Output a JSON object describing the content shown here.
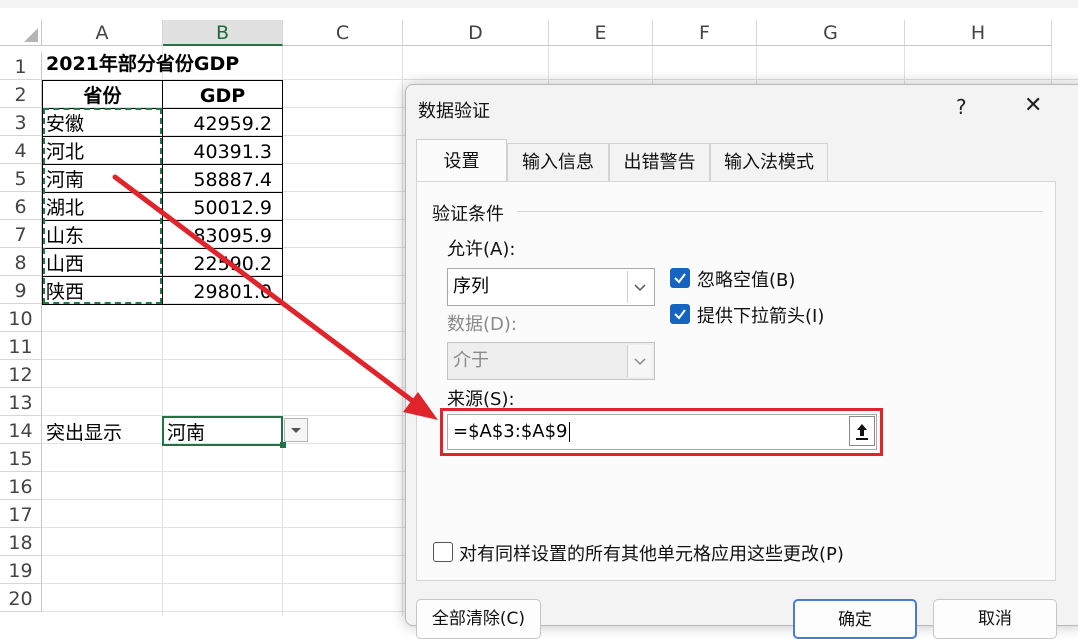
{
  "sheet": {
    "columns": [
      "A",
      "B",
      "C",
      "D",
      "E",
      "F",
      "G",
      "H"
    ],
    "rows": [
      "1",
      "2",
      "3",
      "4",
      "5",
      "6",
      "7",
      "8",
      "9",
      "10",
      "11",
      "12",
      "13",
      "14",
      "15",
      "16",
      "17",
      "18",
      "19",
      "20"
    ],
    "title": "2021年部分省份GDP",
    "headers": {
      "province": "省份",
      "gdp": "GDP"
    },
    "data": [
      {
        "province": "安徽",
        "gdp": "42959.2"
      },
      {
        "province": "河北",
        "gdp": "40391.3"
      },
      {
        "province": "河南",
        "gdp": "58887.4"
      },
      {
        "province": "湖北",
        "gdp": "50012.9"
      },
      {
        "province": "山东",
        "gdp": "83095.9"
      },
      {
        "province": "山西",
        "gdp": "22590.2"
      },
      {
        "province": "陕西",
        "gdp": "29801.0"
      }
    ],
    "highlight_label": "突出显示",
    "highlight_value": "河南"
  },
  "dialog": {
    "title": "数据验证",
    "help": "?",
    "close": "✕",
    "tabs": [
      "设置",
      "输入信息",
      "出错警告",
      "输入法模式"
    ],
    "section": "验证条件",
    "allow_label": "允许(A):",
    "allow_value": "序列",
    "data_label": "数据(D):",
    "data_value": "介于",
    "ignore_blank": "忽略空值(B)",
    "dropdown_arrow": "提供下拉箭头(I)",
    "source_label": "来源(S):",
    "source_value": "=$A$3:$A$9",
    "apply_all": "对有同样设置的所有其他单元格应用这些更改(P)",
    "clear_all": "全部清除(C)",
    "ok": "确定",
    "cancel": "取消"
  },
  "colors": {
    "accent_red": "#e0242c",
    "checkbox_blue": "#1565c0",
    "selection_green": "#217346"
  }
}
